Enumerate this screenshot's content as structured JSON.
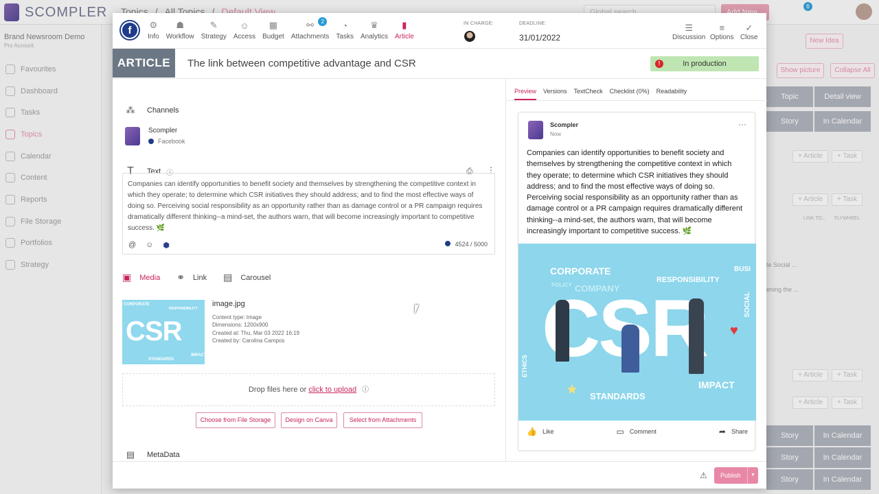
{
  "app": {
    "brand": "SCOMPLER",
    "breadcrumb": [
      "Topics",
      "/",
      "All Topics",
      "/",
      "Default View"
    ],
    "search_placeholder": "Global search",
    "add_new": "Add New",
    "notification_count": "6",
    "workspace": "Brand Newsroom Demo",
    "plan": "Pro Account",
    "sidebar": [
      "Favourites",
      "Dashboard",
      "Tasks",
      "Topics",
      "Calendar",
      "Content",
      "Reports",
      "File Storage",
      "Portfolios",
      "Strategy"
    ],
    "right": {
      "new_idea": "New Idea",
      "show_picture": "Show picture",
      "collapse_all": "Collapse All",
      "topic": "Topic",
      "detail_view": "Detail view",
      "story": "Story",
      "in_calendar": "In Calendar",
      "article_btn": "+ Article",
      "task_btn": "+ Task",
      "col_link": "LINK TO...",
      "col_fly": "FLYWHEEL",
      "snip1": "te Social ...",
      "snip2": "ening the ..."
    }
  },
  "header": {
    "tabs": [
      {
        "label": "Info",
        "icon": "info-icon"
      },
      {
        "label": "Workflow",
        "icon": "workflow-icon"
      },
      {
        "label": "Strategy",
        "icon": "strategy-icon"
      },
      {
        "label": "Access",
        "icon": "access-icon"
      },
      {
        "label": "Budget",
        "icon": "budget-icon"
      },
      {
        "label": "Attachments",
        "icon": "attachments-icon"
      },
      {
        "label": "Tasks",
        "icon": "tasks-icon"
      },
      {
        "label": "Analytics",
        "icon": "analytics-icon"
      },
      {
        "label": "Article",
        "icon": "article-icon"
      }
    ],
    "attachments_count": "2",
    "in_charge_label": "IN CHARGE:",
    "deadline_label": "DEADLINE:",
    "deadline": "31/01/2022",
    "discussion": "Discussion",
    "options": "Options",
    "close": "Close"
  },
  "article": {
    "badge": "ARTICLE",
    "title": "The link between competitive advantage and CSR",
    "status": "In production",
    "status_icon": "!"
  },
  "channels": {
    "heading": "Channels",
    "account": "Scompler",
    "network": "Facebook"
  },
  "text": {
    "heading": "Text",
    "body": "Companies can identify opportunities to benefit society and themselves by strengthening the competitive context in which they operate; to determine which CSR initiatives they should address; and to find the most effective ways of doing so. Perceiving social responsibility as an opportunity rather than as damage control or a PR campaign requires dramatically different thinking--a mind-set, the authors warn, that will become increasingly important to competitive success. 🌿",
    "counter": "4524 / 5000"
  },
  "media": {
    "tabs": [
      "Media",
      "Link",
      "Carousel"
    ],
    "file_name": "image.jpg",
    "content_type": "Content type: Image",
    "dimensions": "Dimensions: 1200x900",
    "created_at": "Created at: Thu, Mar 03 2022 16:19",
    "created_by": "Created by: Carolina Campos",
    "drop_text": "Drop files here or ",
    "upload_link": "click to upload",
    "buttons": [
      "Choose from File Storage",
      "Design on Canva",
      "Select from Attachments"
    ]
  },
  "metadata": {
    "heading": "MetaData"
  },
  "preview": {
    "tabs": [
      "Preview",
      "Versions",
      "TextCheck",
      "Checklist (0%)",
      "Readability"
    ],
    "account": "Scompler",
    "time": "Now",
    "image_words": {
      "corporate": "CORPORATE",
      "responsibility": "RESPONSIBILITY",
      "csr": "CSR",
      "impact": "IMPACT",
      "standards": "STANDARDS",
      "social": "SOCIAL",
      "ethics": "ETHICS",
      "company": "COMPANY",
      "policy": "POLICY",
      "busi": "BUSI"
    },
    "like": "Like",
    "comment": "Comment",
    "share": "Share"
  },
  "footer": {
    "publish": "Publish"
  },
  "colors": {
    "accent": "#c9245a",
    "status": "#bfe6b2",
    "facebook": "#1f3c8a"
  }
}
